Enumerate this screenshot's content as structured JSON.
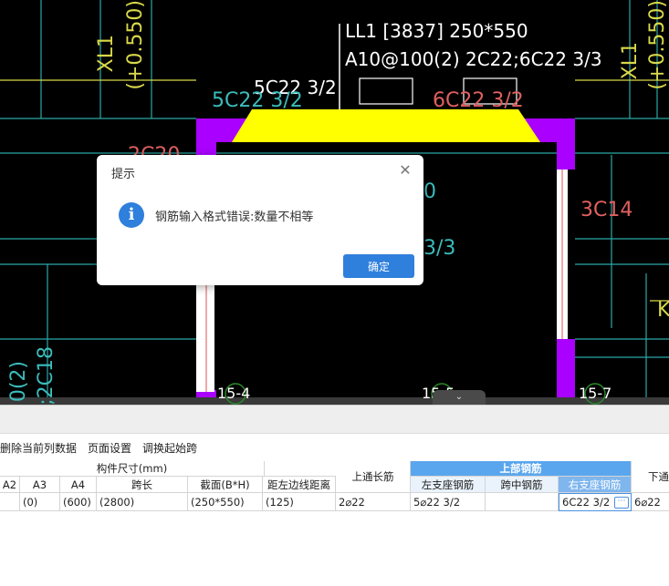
{
  "canvas": {
    "beam_label_line1": "LL1 [3837] 250*550",
    "beam_label_line2": "A10@100(2) 2C22;6C22 3/3",
    "left_support_label": "5C22 3/2",
    "left_support_ghost": "5C22 3/2",
    "right_support_ghost": "6C22 3/2",
    "left_col_label_1": "XL1",
    "left_col_label_2": "(+0.550)",
    "right_col_label_1": "XL1",
    "right_col_label_2": "(+0.550)",
    "left_mid_red": "2C20",
    "right_red": "3C14",
    "center_cyan_1": "0",
    "center_cyan_2": "3/3",
    "left_bottom_cyan_1": "0(2)",
    "left_bottom_cyan_2": "2;2C18",
    "right_edge_k": "K",
    "axis_1": "15-4",
    "axis_2": "15-5",
    "axis_3": "15-7"
  },
  "toolbar": {
    "items": [
      "删除当前列数据",
      "页面设置",
      "调换起始跨"
    ]
  },
  "grid": {
    "group_header": "构件尺寸(mm)",
    "top_rebar_header": "上部钢筋",
    "headers": {
      "a2": "A2",
      "a3": "A3",
      "a4": "A4",
      "span": "跨长",
      "section": "截面(B*H)",
      "edge_dist": "距左边线距离",
      "top_through": "上通长筋",
      "left_support": "左支座钢筋",
      "mid_span": "跨中钢筋",
      "right_support": "右支座钢筋",
      "bottom_through": "下通"
    },
    "row": {
      "a2": "",
      "a3": "(0)",
      "a4": "(600)",
      "span": "(2800)",
      "section": "(250*550)",
      "edge_dist": "(125)",
      "top_through": "2⌀22",
      "left_support": "5⌀22 3/2",
      "mid_span": "",
      "right_support": "6C22 3/2",
      "bottom_through": "6⌀22"
    },
    "edit_button": "⋯"
  },
  "dialog": {
    "title": "提示",
    "close": "✕",
    "icon": "i",
    "message": "钢筋输入格式错误:数量不相等",
    "ok": "确定"
  },
  "collapse_tab": "⌄",
  "colors": {
    "canvas_bg": "#000000",
    "beam_fill": "#ffff00",
    "column_fill": "#aa00ff",
    "dialog_accent": "#2f7fdc",
    "header_blue": "#a9cdf2",
    "header_top_blue": "#5aa6ee"
  }
}
